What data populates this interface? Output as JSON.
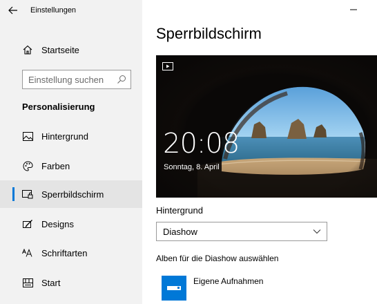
{
  "window": {
    "app_title": "Einstellungen",
    "minimize_glyph": "–"
  },
  "sidebar": {
    "home_label": "Startseite",
    "search_placeholder": "Einstellung suchen",
    "section_header": "Personalisierung",
    "items": [
      {
        "label": "Hintergrund",
        "icon": "picture-icon"
      },
      {
        "label": "Farben",
        "icon": "palette-icon"
      },
      {
        "label": "Sperrbildschirm",
        "icon": "lock-screen-icon",
        "active": true
      },
      {
        "label": "Designs",
        "icon": "brush-icon"
      },
      {
        "label": "Schriftarten",
        "icon": "font-icon"
      },
      {
        "label": "Start",
        "icon": "start-icon"
      }
    ]
  },
  "main": {
    "page_title": "Sperrbildschirm",
    "preview": {
      "time": "20:08",
      "date": "Sonntag, 8. April"
    },
    "background_label": "Hintergrund",
    "background_value": "Diashow",
    "albums_label": "Alben für die Diashow auswählen",
    "album_name": "Eigene Aufnahmen"
  },
  "colors": {
    "accent": "#0078d7",
    "sidebar_bg": "#f2f2f2",
    "active_item_bg": "#e4e4e4"
  }
}
